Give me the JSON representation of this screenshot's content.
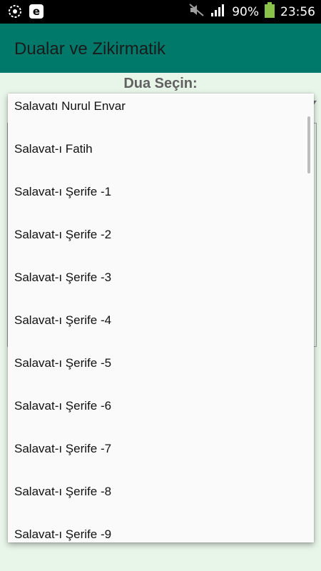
{
  "status_bar": {
    "battery_percent": "90%",
    "time": "23:56",
    "icons": [
      "sync-icon",
      "browser-e-icon",
      "mute-icon",
      "signal-icon",
      "battery-icon"
    ]
  },
  "app_bar": {
    "title": "Dualar ve Zikirmatik"
  },
  "main": {
    "prompt_label": "Dua Seçin:"
  },
  "dropdown": {
    "items": [
      "Salavatı Nurul Envar",
      "Salavat-ı Fatih",
      "Salavat-ı Şerife -1",
      "Salavat-ı Şerife -2",
      "Salavat-ı Şerife -3",
      "Salavat-ı Şerife -4",
      "Salavat-ı Şerife -5",
      "Salavat-ı Şerife -6",
      "Salavat-ı Şerife -7",
      "Salavat-ı Şerife -8",
      "Salavat-ı Şerife -9"
    ]
  },
  "colors": {
    "app_bar": "#00796b",
    "background": "#e8f5e9",
    "status_bar": "#000000",
    "battery": "#8bc34a"
  }
}
